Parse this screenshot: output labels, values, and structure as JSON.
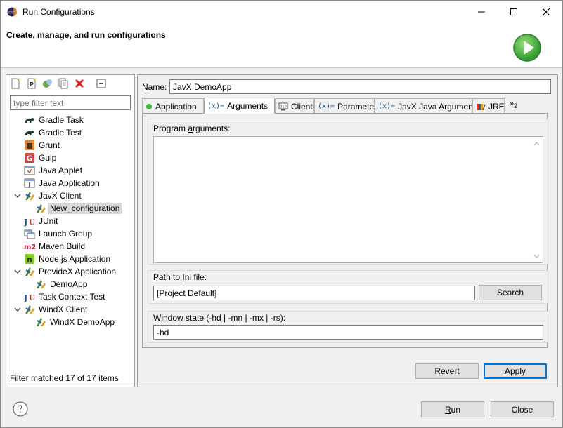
{
  "window": {
    "title": "Run Configurations"
  },
  "banner": {
    "heading": "Create, manage, and run configurations"
  },
  "left": {
    "filter_placeholder": "type filter text",
    "filter_value": "",
    "items": [
      {
        "label": "Gradle Task",
        "icon": "gradle-icon",
        "level": 0
      },
      {
        "label": "Gradle Test",
        "icon": "gradle-icon",
        "level": 0
      },
      {
        "label": "Grunt",
        "icon": "grunt-icon",
        "level": 0
      },
      {
        "label": "Gulp",
        "icon": "gulp-icon",
        "level": 0
      },
      {
        "label": "Java Applet",
        "icon": "java-applet-icon",
        "level": 0
      },
      {
        "label": "Java Application",
        "icon": "java-application-icon",
        "level": 0
      },
      {
        "label": "JavX Client",
        "icon": "javx-icon",
        "level": 0,
        "expanded": true
      },
      {
        "label": "New_configuration",
        "icon": "javx-icon",
        "level": 1,
        "selected": true
      },
      {
        "label": "JUnit",
        "icon": "junit-icon",
        "level": 0
      },
      {
        "label": "Launch Group",
        "icon": "launch-group-icon",
        "level": 0
      },
      {
        "label": "Maven Build",
        "icon": "maven-icon",
        "level": 0
      },
      {
        "label": "Node.js Application",
        "icon": "nodejs-icon",
        "level": 0
      },
      {
        "label": "ProvideX Application",
        "icon": "javx-icon",
        "level": 0,
        "expanded": true
      },
      {
        "label": "DemoApp",
        "icon": "javx-icon",
        "level": 1
      },
      {
        "label": "Task Context Test",
        "icon": "junit-icon",
        "level": 0
      },
      {
        "label": "WindX Client",
        "icon": "javx-icon",
        "level": 0,
        "expanded": true
      },
      {
        "label": "WindX DemoApp",
        "icon": "javx-icon",
        "level": 1
      }
    ],
    "status": "Filter matched 17 of 17 items"
  },
  "right": {
    "name_label": "Name:",
    "name_value": "JavX DemoApp",
    "tabs": [
      {
        "label": "Application",
        "icon": "green-dot-icon"
      },
      {
        "label": "Arguments",
        "icon": "variable-icon",
        "active": true
      },
      {
        "label": "Client",
        "icon": "client-icon"
      },
      {
        "label": "Parameters",
        "icon": "variable-icon"
      },
      {
        "label": "JavX Java Arguments",
        "icon": "variable-icon"
      },
      {
        "label": "JRE",
        "icon": "jre-icon"
      }
    ],
    "tab_overflow": "»",
    "tab_overflow_count": "2",
    "program_args_label": "Program arguments:",
    "program_args_value": "",
    "ini_label": "Path to Ini file:",
    "ini_value": "[Project Default]",
    "search_label": "Search",
    "state_label": "Window state (-hd | -mn | -mx | -rs):",
    "state_value": "-hd",
    "revert_label": "Revert",
    "apply_label": "Apply"
  },
  "footer": {
    "run_label": "Run",
    "close_label": "Close"
  },
  "colors": {
    "accent": "#0078d7",
    "selected": "#d9d9d9",
    "run_green": "#3bb53b"
  }
}
